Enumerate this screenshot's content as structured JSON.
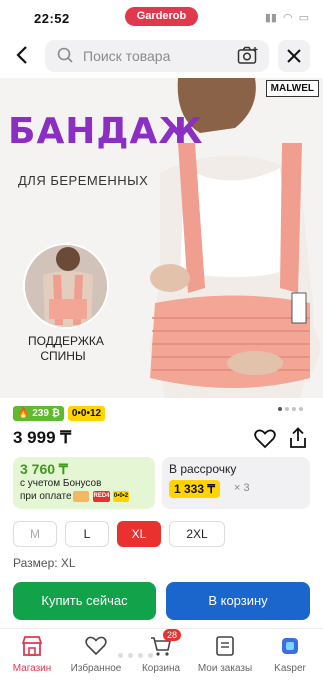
{
  "status": {
    "time": "22:52",
    "app_pill": "Garderob"
  },
  "search": {
    "placeholder": "Поиск товара"
  },
  "hero": {
    "brand": "MALWEL",
    "title": "БАНДАЖ",
    "subtitle": "ДЛЯ БЕРЕМЕННЫХ",
    "caption_line1": "ПОДДЕРЖКА",
    "caption_line2": "СПИНЫ"
  },
  "badges": {
    "green": "239 ₿",
    "yellow": "0•0•12"
  },
  "product": {
    "price": "3 999 ₸"
  },
  "bonus_card": {
    "amount": "3 760 ₸",
    "line1": "с учетом Бонусов",
    "line2": "при оплате",
    "logo1": "",
    "logo2": "RED4",
    "logo3": "0•0•2"
  },
  "install_card": {
    "title": "В рассрочку",
    "amount": "1 333 ₸",
    "times": "× 3"
  },
  "sizes": {
    "options": [
      "M",
      "L",
      "XL",
      "2XL"
    ],
    "selected": "XL",
    "label": "Размер: XL"
  },
  "actions": {
    "buy_label": "Купить сейчас",
    "cart_label": "В корзину"
  },
  "tabbar": {
    "items": [
      {
        "label": "Магазин"
      },
      {
        "label": "Избранное"
      },
      {
        "label": "Корзина",
        "badge": "28"
      },
      {
        "label": "Мои заказы"
      },
      {
        "label": "Kasper"
      }
    ]
  },
  "colors": {
    "accent": "#e0394e",
    "buy": "#12a34a",
    "cart": "#1a66cc",
    "title_purple": "#8a2fc2"
  }
}
